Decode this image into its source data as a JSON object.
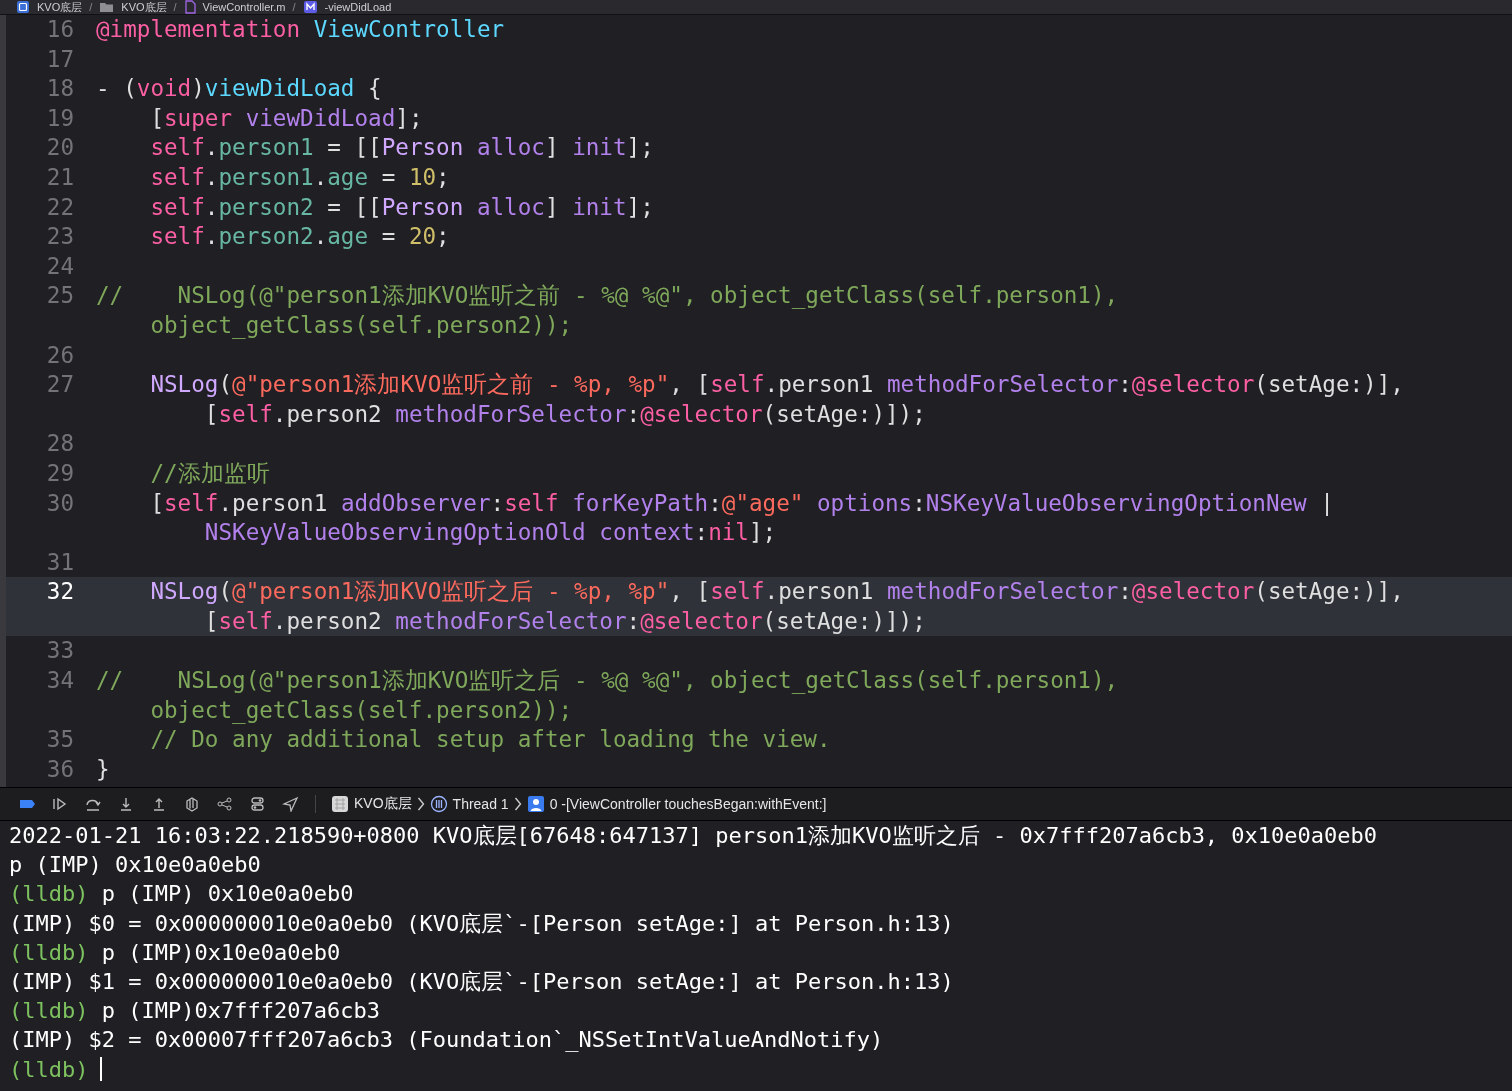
{
  "breadcrumb": {
    "separator": "/",
    "items": [
      {
        "kind": "app",
        "label": "KVO底层"
      },
      {
        "kind": "folder",
        "label": "KVO底层"
      },
      {
        "kind": "file",
        "label": "ViewController.m"
      },
      {
        "kind": "method",
        "label": "-viewDidLoad"
      }
    ]
  },
  "editor": {
    "lines": [
      {
        "number": "16",
        "selected": false,
        "wraps": [
          {
            "tokens": [
              {
                "kind": "kw",
                "text": "@implementation "
              },
              {
                "kind": "decl",
                "text": "ViewController"
              }
            ]
          }
        ]
      },
      {
        "number": "17",
        "selected": false
      },
      {
        "number": "18",
        "selected": false,
        "wraps": [
          {
            "tokens": [
              {
                "kind": "plain",
                "text": "- ("
              },
              {
                "kind": "kw",
                "text": "void"
              },
              {
                "kind": "plain",
                "text": ")"
              },
              {
                "kind": "decl",
                "text": "viewDidLoad"
              },
              {
                "kind": "plain",
                "text": " {"
              }
            ]
          }
        ]
      },
      {
        "number": "19",
        "selected": false,
        "wraps": [
          {
            "tokens": [
              {
                "kind": "plain",
                "text": "    ["
              },
              {
                "kind": "kw",
                "text": "super "
              },
              {
                "kind": "method",
                "text": "viewDidLoad"
              },
              {
                "kind": "plain",
                "text": "];"
              }
            ]
          }
        ]
      },
      {
        "number": "20",
        "selected": false,
        "wraps": [
          {
            "tokens": [
              {
                "kind": "kw",
                "text": "    self"
              },
              {
                "kind": "plain",
                "text": "."
              },
              {
                "kind": "prop",
                "text": "person1"
              },
              {
                "kind": "plain",
                "text": " = [["
              },
              {
                "kind": "type",
                "text": "Person "
              },
              {
                "kind": "method",
                "text": "alloc"
              },
              {
                "kind": "plain",
                "text": "] "
              },
              {
                "kind": "method",
                "text": "init"
              },
              {
                "kind": "plain",
                "text": "];"
              }
            ]
          }
        ]
      },
      {
        "number": "21",
        "selected": false,
        "wraps": [
          {
            "tokens": [
              {
                "kind": "kw",
                "text": "    self"
              },
              {
                "kind": "plain",
                "text": "."
              },
              {
                "kind": "prop",
                "text": "person1"
              },
              {
                "kind": "plain",
                "text": "."
              },
              {
                "kind": "prop",
                "text": "age"
              },
              {
                "kind": "plain",
                "text": " = "
              },
              {
                "kind": "num",
                "text": "10"
              },
              {
                "kind": "plain",
                "text": ";"
              }
            ]
          }
        ]
      },
      {
        "number": "22",
        "selected": false,
        "wraps": [
          {
            "tokens": [
              {
                "kind": "kw",
                "text": "    self"
              },
              {
                "kind": "plain",
                "text": "."
              },
              {
                "kind": "prop",
                "text": "person2"
              },
              {
                "kind": "plain",
                "text": " = [["
              },
              {
                "kind": "type",
                "text": "Person "
              },
              {
                "kind": "method",
                "text": "alloc"
              },
              {
                "kind": "plain",
                "text": "] "
              },
              {
                "kind": "method",
                "text": "init"
              },
              {
                "kind": "plain",
                "text": "];"
              }
            ]
          }
        ]
      },
      {
        "number": "23",
        "selected": false,
        "wraps": [
          {
            "tokens": [
              {
                "kind": "kw",
                "text": "    self"
              },
              {
                "kind": "plain",
                "text": "."
              },
              {
                "kind": "prop",
                "text": "person2"
              },
              {
                "kind": "plain",
                "text": "."
              },
              {
                "kind": "prop",
                "text": "age"
              },
              {
                "kind": "plain",
                "text": " = "
              },
              {
                "kind": "num",
                "text": "20"
              },
              {
                "kind": "plain",
                "text": ";"
              }
            ]
          }
        ]
      },
      {
        "number": "24",
        "selected": false
      },
      {
        "number": "25",
        "selected": false,
        "wraps": [
          {
            "tokens": [
              {
                "kind": "comment",
                "text": "//    NSLog(@\"person1添加KVO监听之前 - %@ %@\", object_getClass(self.person1),"
              }
            ]
          },
          {
            "tokens": [
              {
                "kind": "comment",
                "text": "    object_getClass(self.person2));"
              }
            ]
          }
        ]
      },
      {
        "number": "26",
        "selected": false
      },
      {
        "number": "27",
        "selected": false,
        "wraps": [
          {
            "tokens": [
              {
                "kind": "type",
                "text": "    NSLog"
              },
              {
                "kind": "plain",
                "text": "("
              },
              {
                "kind": "str",
                "text": "@\"person1添加KVO监听之前 - %p, %p\""
              },
              {
                "kind": "plain",
                "text": ", ["
              },
              {
                "kind": "kw",
                "text": "self"
              },
              {
                "kind": "plain",
                "text": ".person1 "
              },
              {
                "kind": "method",
                "text": "methodForSelector"
              },
              {
                "kind": "plain",
                "text": ":"
              },
              {
                "kind": "kw",
                "text": "@selector"
              },
              {
                "kind": "plain",
                "text": "(setAge:)],"
              }
            ]
          },
          {
            "tokens": [
              {
                "kind": "plain",
                "text": "        ["
              },
              {
                "kind": "kw",
                "text": "self"
              },
              {
                "kind": "plain",
                "text": ".person2 "
              },
              {
                "kind": "method",
                "text": "methodForSelector"
              },
              {
                "kind": "plain",
                "text": ":"
              },
              {
                "kind": "kw",
                "text": "@selector"
              },
              {
                "kind": "plain",
                "text": "(setAge:)]);"
              }
            ]
          }
        ]
      },
      {
        "number": "28",
        "selected": false
      },
      {
        "number": "29",
        "selected": false,
        "wraps": [
          {
            "tokens": [
              {
                "kind": "comment",
                "text": "    //添加监听"
              }
            ]
          }
        ]
      },
      {
        "number": "30",
        "selected": false,
        "wraps": [
          {
            "tokens": [
              {
                "kind": "plain",
                "text": "    ["
              },
              {
                "kind": "kw",
                "text": "self"
              },
              {
                "kind": "plain",
                "text": ".person1 "
              },
              {
                "kind": "method",
                "text": "addObserver"
              },
              {
                "kind": "plain",
                "text": ":"
              },
              {
                "kind": "kw",
                "text": "self "
              },
              {
                "kind": "method",
                "text": "forKeyPath"
              },
              {
                "kind": "plain",
                "text": ":"
              },
              {
                "kind": "str",
                "text": "@\"age\" "
              },
              {
                "kind": "method",
                "text": "options"
              },
              {
                "kind": "plain",
                "text": ":"
              },
              {
                "kind": "method",
                "text": "NSKeyValueObservingOptionNew"
              },
              {
                "kind": "plain",
                "text": " |"
              }
            ]
          },
          {
            "tokens": [
              {
                "kind": "method",
                "text": "        NSKeyValueObservingOptionOld "
              },
              {
                "kind": "method",
                "text": "context"
              },
              {
                "kind": "plain",
                "text": ":"
              },
              {
                "kind": "kw",
                "text": "nil"
              },
              {
                "kind": "plain",
                "text": "];"
              }
            ]
          }
        ]
      },
      {
        "number": "31",
        "selected": false
      },
      {
        "number": "32",
        "selected": true,
        "wraps": [
          {
            "tokens": [
              {
                "kind": "type",
                "text": "    NSLog"
              },
              {
                "kind": "plain",
                "text": "("
              },
              {
                "kind": "str",
                "text": "@\"person1添加KVO监听之后 - %p, %p\""
              },
              {
                "kind": "plain",
                "text": ", ["
              },
              {
                "kind": "kw",
                "text": "self"
              },
              {
                "kind": "plain",
                "text": ".person1 "
              },
              {
                "kind": "method",
                "text": "methodForSelector"
              },
              {
                "kind": "plain",
                "text": ":"
              },
              {
                "kind": "kw",
                "text": "@selector"
              },
              {
                "kind": "plain",
                "text": "(setAge:)],"
              }
            ]
          },
          {
            "tokens": [
              {
                "kind": "plain",
                "text": "        ["
              },
              {
                "kind": "kw",
                "text": "self"
              },
              {
                "kind": "plain",
                "text": ".person2 "
              },
              {
                "kind": "method",
                "text": "methodForSelector"
              },
              {
                "kind": "plain",
                "text": ":"
              },
              {
                "kind": "kw",
                "text": "@selector"
              },
              {
                "kind": "plain",
                "text": "(setAge:)]);"
              }
            ]
          }
        ]
      },
      {
        "number": "33",
        "selected": false
      },
      {
        "number": "34",
        "selected": false,
        "wraps": [
          {
            "tokens": [
              {
                "kind": "comment",
                "text": "//    NSLog(@\"person1添加KVO监听之后 - %@ %@\", object_getClass(self.person1),"
              }
            ]
          },
          {
            "tokens": [
              {
                "kind": "comment",
                "text": "    object_getClass(self.person2));"
              }
            ]
          }
        ]
      },
      {
        "number": "35",
        "selected": false,
        "wraps": [
          {
            "tokens": [
              {
                "kind": "comment",
                "text": "    // Do any additional setup after loading the view."
              }
            ]
          }
        ]
      },
      {
        "number": "36",
        "selected": false,
        "wraps": [
          {
            "tokens": [
              {
                "kind": "plain",
                "text": "}"
              }
            ]
          }
        ]
      }
    ]
  },
  "debug_bar": {
    "path": [
      {
        "kind": "app",
        "label": "KVO底层"
      },
      {
        "kind": "thread",
        "label": "Thread 1"
      },
      {
        "kind": "frame",
        "label": "0 -[ViewController touchesBegan:withEvent:]"
      }
    ]
  },
  "console": {
    "lines": [
      {
        "parts": [
          {
            "kind": "output",
            "text": "2022-01-21 16:03:22.218590+0800 KVO底层[67648:647137] person1添加KVO监听之后 - 0x7fff207a6cb3, 0x10e0a0eb0"
          }
        ]
      },
      {
        "parts": [
          {
            "kind": "output",
            "text": "p (IMP) 0x10e0a0eb0"
          }
        ]
      },
      {
        "parts": [
          {
            "kind": "prompt",
            "text": "(lldb)"
          },
          {
            "kind": "output",
            "text": " p (IMP) 0x10e0a0eb0"
          }
        ]
      },
      {
        "parts": [
          {
            "kind": "output",
            "text": "(IMP) $0 = 0x000000010e0a0eb0 (KVO底层`-[Person setAge:] at Person.h:13)"
          }
        ]
      },
      {
        "parts": [
          {
            "kind": "prompt",
            "text": "(lldb)"
          },
          {
            "kind": "output",
            "text": " p (IMP)0x10e0a0eb0"
          }
        ]
      },
      {
        "parts": [
          {
            "kind": "output",
            "text": "(IMP) $1 = 0x000000010e0a0eb0 (KVO底层`-[Person setAge:] at Person.h:13)"
          }
        ]
      },
      {
        "parts": [
          {
            "kind": "prompt",
            "text": "(lldb)"
          },
          {
            "kind": "output",
            "text": " p (IMP)0x7fff207a6cb3"
          }
        ]
      },
      {
        "parts": [
          {
            "kind": "output",
            "text": "(IMP) $2 = 0x00007fff207a6cb3 (Foundation`_NSSetIntValueAndNotify)"
          }
        ]
      },
      {
        "parts": [
          {
            "kind": "prompt",
            "text": "(lldb)"
          }
        ]
      }
    ]
  }
}
